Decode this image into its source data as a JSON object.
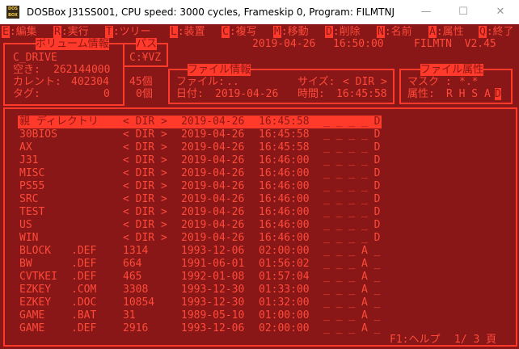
{
  "window": {
    "title": "DOSBox J31SS001, CPU speed:     3000 cycles, Frameskip  0, Program:  FILMTNJ",
    "icon_text": "DOS BOX",
    "minimize": "—",
    "maximize": "☐",
    "close": "✕"
  },
  "menu": [
    {
      "key": "E",
      "label": ":編集"
    },
    {
      "key": "R",
      "label": ":実行"
    },
    {
      "key": "T",
      "label": ":ツリー"
    },
    {
      "key": "L",
      "label": ":装置"
    },
    {
      "key": "C",
      "label": ":複写"
    },
    {
      "key": "M",
      "label": ":移動"
    },
    {
      "key": "D",
      "label": ":削除"
    },
    {
      "key": "N",
      "label": ":名前"
    },
    {
      "key": "A",
      "label": ":属性"
    },
    {
      "key": "Q",
      "label": ":終了"
    }
  ],
  "header": {
    "volume_title": "ボリューム情報",
    "path_title": "パス",
    "date": "2019-04-26",
    "time": "16:50:00",
    "app_version": "FILMTN  V2.45"
  },
  "volume": {
    "name": "C_DRIVE",
    "free_label": "空き:",
    "free_value": "262144000",
    "current_label": "カレント:",
    "current_bytes": "402304",
    "current_count": "45個",
    "tag_label": "タグ:",
    "tag_bytes": "0",
    "tag_count": "0個"
  },
  "path": {
    "value": "C:¥VZ"
  },
  "fileinfo": {
    "title": "ファイル情報",
    "file_label": "ファイル:",
    "file_value": "..",
    "size_label": "サイズ:",
    "size_value": "< DIR >",
    "date_label": "日付:",
    "date_value": "2019-04-26",
    "time_label": "時間:",
    "time_value": "16:45:58"
  },
  "attrs": {
    "title": "ファイル属性",
    "mask_label": "マスク :",
    "mask_value": "*.*",
    "attr_label": "属性:",
    "attr_value": "R H S A",
    "attr_last": "D"
  },
  "files": [
    {
      "name": "親 ディレクトリ",
      "ext": "",
      "size": "< DIR >",
      "date": "2019-04-26",
      "time": "16:45:58",
      "attr": "_ _ _ _ D",
      "selected": true
    },
    {
      "name": "30BIOS",
      "ext": "",
      "size": "< DIR >",
      "date": "2019-04-26",
      "time": "16:45:58",
      "attr": "_ _ _ _ D"
    },
    {
      "name": "AX",
      "ext": "",
      "size": "< DIR >",
      "date": "2019-04-26",
      "time": "16:45:58",
      "attr": "_ _ _ _ D"
    },
    {
      "name": "J31",
      "ext": "",
      "size": "< DIR >",
      "date": "2019-04-26",
      "time": "16:46:00",
      "attr": "_ _ _ _ D"
    },
    {
      "name": "MISC",
      "ext": "",
      "size": "< DIR >",
      "date": "2019-04-26",
      "time": "16:46:00",
      "attr": "_ _ _ _ D"
    },
    {
      "name": "PS55",
      "ext": "",
      "size": "< DIR >",
      "date": "2019-04-26",
      "time": "16:46:00",
      "attr": "_ _ _ _ D"
    },
    {
      "name": "SRC",
      "ext": "",
      "size": "< DIR >",
      "date": "2019-04-26",
      "time": "16:46:00",
      "attr": "_ _ _ _ D"
    },
    {
      "name": "TEST",
      "ext": "",
      "size": "< DIR >",
      "date": "2019-04-26",
      "time": "16:46:00",
      "attr": "_ _ _ _ D"
    },
    {
      "name": "US",
      "ext": "",
      "size": "< DIR >",
      "date": "2019-04-26",
      "time": "16:46:00",
      "attr": "_ _ _ _ D"
    },
    {
      "name": "WIN",
      "ext": "",
      "size": "< DIR >",
      "date": "2019-04-26",
      "time": "16:46:00",
      "attr": "_ _ _ _ D"
    },
    {
      "name": "BLOCK",
      "ext": ".DEF",
      "size": "1314",
      "date": "1993-12-06",
      "time": "02:00:00",
      "attr": "_ _ _ A _"
    },
    {
      "name": "BW",
      "ext": ".DEF",
      "size": "664",
      "date": "1991-06-01",
      "time": "01:56:02",
      "attr": "_ _ _ A _"
    },
    {
      "name": "CVTKEI",
      "ext": ".DEF",
      "size": "465",
      "date": "1992-01-08",
      "time": "01:57:04",
      "attr": "_ _ _ A _"
    },
    {
      "name": "EZKEY",
      "ext": ".COM",
      "size": "3308",
      "date": "1993-12-30",
      "time": "01:33:00",
      "attr": "_ _ _ A _"
    },
    {
      "name": "EZKEY",
      "ext": ".DOC",
      "size": "10854",
      "date": "1993-12-30",
      "time": "01:32:00",
      "attr": "_ _ _ A _"
    },
    {
      "name": "GAME",
      "ext": ".BAT",
      "size": "31",
      "date": "1989-05-10",
      "time": "01:00:00",
      "attr": "_ _ _ A _"
    },
    {
      "name": "GAME",
      "ext": ".DEF",
      "size": "2916",
      "date": "1993-12-06",
      "time": "02:00:00",
      "attr": "_ _ _ A _"
    }
  ],
  "footer": {
    "help": "F1:ヘルプ",
    "page": "1/ 3 頁"
  },
  "colors": {
    "fg": "#ff3a2a",
    "bg": "#8a1717"
  }
}
